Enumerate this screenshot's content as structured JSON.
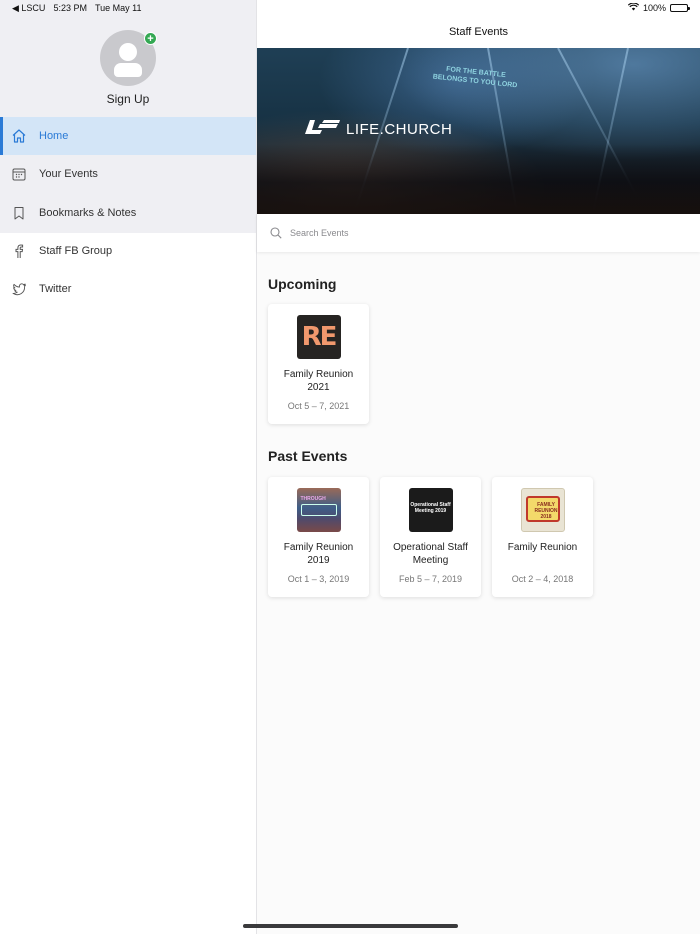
{
  "status_bar": {
    "back_app": "◀ LSCU",
    "time": "5:23 PM",
    "date": "Tue May 11",
    "battery": "100%"
  },
  "sidebar": {
    "profile": {
      "label": "Sign Up"
    },
    "items": [
      {
        "label": "Home",
        "icon": "home-icon",
        "active": true
      },
      {
        "label": "Your Events",
        "icon": "calendar-icon",
        "active": false
      },
      {
        "label": "Bookmarks & Notes",
        "icon": "bookmark-icon",
        "active": false
      },
      {
        "label": "Staff FB Group",
        "icon": "facebook-icon",
        "active": false
      },
      {
        "label": "Twitter",
        "icon": "twitter-icon",
        "active": false
      }
    ]
  },
  "main": {
    "title": "Staff Events",
    "hero": {
      "brand": "LIFE.CHURCH",
      "tagline_1": "FOR THE BATTLE",
      "tagline_2": "BELONGS TO YOU LORD"
    },
    "search": {
      "placeholder": "Search Events"
    },
    "upcoming": {
      "title": "Upcoming",
      "events": [
        {
          "name": "Family Reunion 2021",
          "date": "Oct 5 – 7, 2021",
          "thumb_text": "RE"
        }
      ]
    },
    "past": {
      "title": "Past Events",
      "events": [
        {
          "name": "Family Reunion 2019",
          "date": "Oct 1 – 3, 2019",
          "thumb_text_1": "THROUGH",
          "thumb_text_2": "FAMILY REUNION"
        },
        {
          "name": "Operational Staff Meeting",
          "date": "Feb 5 – 7, 2019",
          "thumb_text": "Operational Staff Meeting 2019"
        },
        {
          "name": "Family Reunion",
          "date": "Oct 2 – 4, 2018",
          "thumb_text": "FAMILY REUNION 2018"
        }
      ]
    }
  },
  "colors": {
    "accent": "#2a7ad6",
    "active_bg": "#d3e5f7",
    "sidebar_bg": "#efeff3",
    "badge_green": "#34a853"
  }
}
